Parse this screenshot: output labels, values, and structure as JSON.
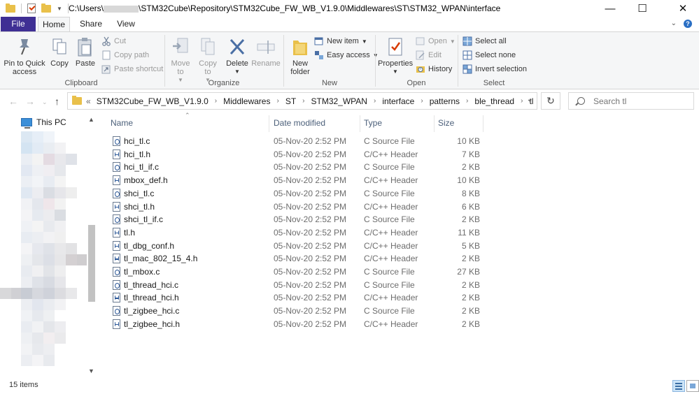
{
  "window": {
    "title_prefix": "C:\\Users\\",
    "title_suffix": "\\STM32Cube\\Repository\\STM32Cube_FW_WB_V1.9.0\\Middlewares\\ST\\STM32_WPAN\\interface",
    "minimize": "—",
    "maximize": "☐",
    "close": "✕"
  },
  "ribbon_tabs": [
    "File",
    "Home",
    "Share",
    "View"
  ],
  "ribbon": {
    "clipboard": {
      "label": "Clipboard",
      "pin": "Pin to Quick access",
      "copy": "Copy",
      "paste": "Paste",
      "cut": "Cut",
      "copy_path": "Copy path",
      "paste_shortcut": "Paste shortcut"
    },
    "organize": {
      "label": "Organize",
      "move_to": "Move to",
      "copy_to": "Copy to",
      "delete": "Delete",
      "rename": "Rename"
    },
    "new": {
      "label": "New",
      "new_folder": "New folder",
      "new_item": "New item",
      "easy_access": "Easy access"
    },
    "open": {
      "label": "Open",
      "properties": "Properties",
      "open": "Open",
      "edit": "Edit",
      "history": "History"
    },
    "select": {
      "label": "Select",
      "select_all": "Select all",
      "select_none": "Select none",
      "invert_selection": "Invert selection"
    }
  },
  "address": {
    "overflow": "«",
    "crumbs": [
      "STM32Cube_FW_WB_V1.9.0",
      "Middlewares",
      "ST",
      "STM32_WPAN",
      "interface",
      "patterns",
      "ble_thread",
      "tl"
    ]
  },
  "search": {
    "placeholder": "Search tl"
  },
  "nav": {
    "this_pc": "This PC"
  },
  "columns": {
    "name": "Name",
    "date": "Date modified",
    "type": "Type",
    "size": "Size"
  },
  "files": [
    {
      "name": "hci_tl.c",
      "date": "05-Nov-20 2:52 PM",
      "type": "C Source File",
      "size": "10 KB",
      "kind": "c"
    },
    {
      "name": "hci_tl.h",
      "date": "05-Nov-20 2:52 PM",
      "type": "C/C++ Header",
      "size": "7 KB",
      "kind": "h"
    },
    {
      "name": "hci_tl_if.c",
      "date": "05-Nov-20 2:52 PM",
      "type": "C Source File",
      "size": "2 KB",
      "kind": "c"
    },
    {
      "name": "mbox_def.h",
      "date": "05-Nov-20 2:52 PM",
      "type": "C/C++ Header",
      "size": "10 KB",
      "kind": "h"
    },
    {
      "name": "shci_tl.c",
      "date": "05-Nov-20 2:52 PM",
      "type": "C Source File",
      "size": "8 KB",
      "kind": "c"
    },
    {
      "name": "shci_tl.h",
      "date": "05-Nov-20 2:52 PM",
      "type": "C/C++ Header",
      "size": "6 KB",
      "kind": "h"
    },
    {
      "name": "shci_tl_if.c",
      "date": "05-Nov-20 2:52 PM",
      "type": "C Source File",
      "size": "2 KB",
      "kind": "c"
    },
    {
      "name": "tl.h",
      "date": "05-Nov-20 2:52 PM",
      "type": "C/C++ Header",
      "size": "11 KB",
      "kind": "h"
    },
    {
      "name": "tl_dbg_conf.h",
      "date": "05-Nov-20 2:52 PM",
      "type": "C/C++ Header",
      "size": "5 KB",
      "kind": "h"
    },
    {
      "name": "tl_mac_802_15_4.h",
      "date": "05-Nov-20 2:52 PM",
      "type": "C/C++ Header",
      "size": "2 KB",
      "kind": "h"
    },
    {
      "name": "tl_mbox.c",
      "date": "05-Nov-20 2:52 PM",
      "type": "C Source File",
      "size": "27 KB",
      "kind": "c"
    },
    {
      "name": "tl_thread_hci.c",
      "date": "05-Nov-20 2:52 PM",
      "type": "C Source File",
      "size": "2 KB",
      "kind": "c"
    },
    {
      "name": "tl_thread_hci.h",
      "date": "05-Nov-20 2:52 PM",
      "type": "C/C++ Header",
      "size": "2 KB",
      "kind": "h"
    },
    {
      "name": "tl_zigbee_hci.c",
      "date": "05-Nov-20 2:52 PM",
      "type": "C Source File",
      "size": "2 KB",
      "kind": "c"
    },
    {
      "name": "tl_zigbee_hci.h",
      "date": "05-Nov-20 2:52 PM",
      "type": "C/C++ Header",
      "size": "2 KB",
      "kind": "h"
    }
  ],
  "status": {
    "items": "15 items"
  },
  "colors": {
    "file_tab": "#3f2f94",
    "folder": "#e9c04a",
    "header_text": "#4c607a"
  }
}
